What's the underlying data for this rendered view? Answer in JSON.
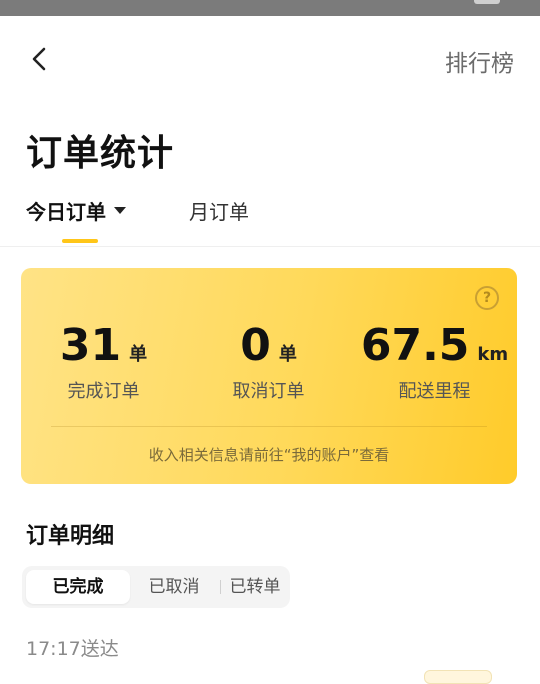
{
  "header": {
    "back_icon": "chevron-left-icon",
    "rank_label": "排行榜"
  },
  "page_title": "订单统计",
  "tabs": {
    "today": "今日订单",
    "month": "月订单"
  },
  "stats": {
    "completed": {
      "value": "31",
      "unit": "单",
      "label": "完成订单"
    },
    "cancelled": {
      "value": "0",
      "unit": "单",
      "label": "取消订单"
    },
    "distance": {
      "value": "67.5",
      "unit": "km",
      "label": "配送里程"
    },
    "note": "收入相关信息请前往“我的账户”查看",
    "help_icon": "question-circle-icon"
  },
  "details": {
    "title": "订单明细",
    "filters": [
      "已完成",
      "已取消",
      "已转单"
    ],
    "active_filter": "已完成"
  },
  "first_order": {
    "time_label": "17:17送达"
  },
  "colors": {
    "accent": "#ffc619",
    "card_start": "#ffe386",
    "card_end": "#ffcb2a"
  }
}
